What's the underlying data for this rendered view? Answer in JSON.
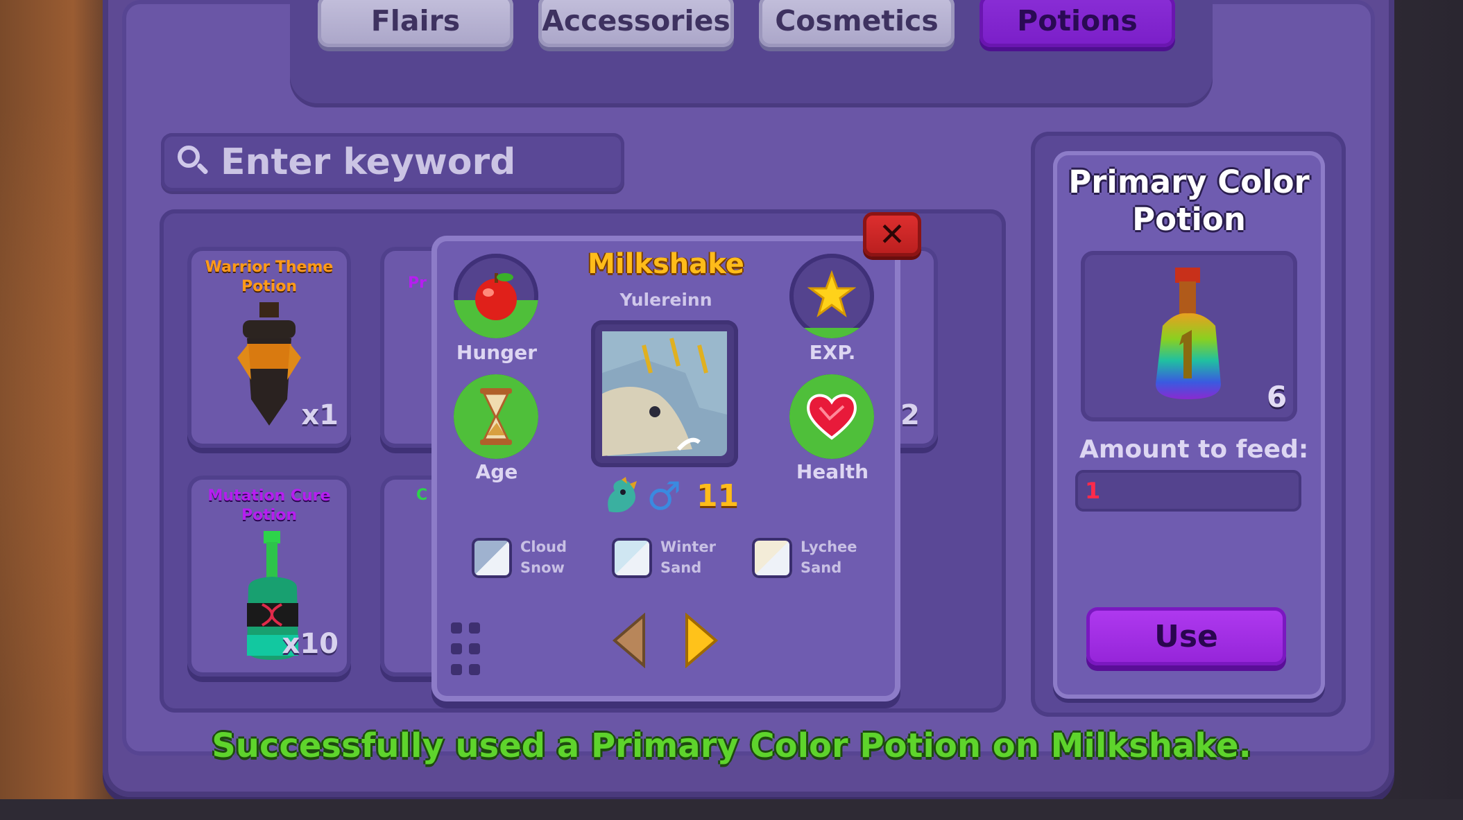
{
  "tabs": [
    {
      "label": "Flairs",
      "active": false
    },
    {
      "label": "Accessories",
      "active": false
    },
    {
      "label": "Cosmetics",
      "active": false
    },
    {
      "label": "Potions",
      "active": true
    }
  ],
  "search": {
    "placeholder": "Enter keyword"
  },
  "items": [
    {
      "name_line1": "Warrior Theme",
      "name_line2": "Potion",
      "count": "x1",
      "name_color": "#ff9a1a"
    },
    {
      "name_line1": "Mutation Cure",
      "name_line2": "Potion",
      "count": "x10",
      "name_color": "#b61ef0"
    }
  ],
  "partial_text": {
    "card2_top": "Pr",
    "card2_bottom": "C",
    "card3_count": "2"
  },
  "popup": {
    "close_label": "✕",
    "pet_name": "Milkshake",
    "species": "Yulereinn",
    "stats": {
      "hunger": {
        "label": "Hunger",
        "level": 0.45
      },
      "exp": {
        "label": "EXP.",
        "level": 0.12
      },
      "age": {
        "label": "Age"
      },
      "health": {
        "label": "Health"
      }
    },
    "gender": "male",
    "gender_symbol": "♂",
    "level": "11",
    "colors": [
      {
        "line1": "Cloud",
        "line2": "Snow",
        "hex": "#9fb2cf"
      },
      {
        "line1": "Winter",
        "line2": "Sand",
        "hex": "#cfe6f2"
      },
      {
        "line1": "Lychee",
        "line2": "Sand",
        "hex": "#f3ecd8"
      }
    ],
    "icons": [
      "apple-icon",
      "star-icon",
      "hourglass-icon",
      "heart-icon",
      "dragon-icon",
      "male-icon",
      "grid-menu-icon",
      "prev-arrow-icon",
      "next-arrow-icon"
    ]
  },
  "side": {
    "title_line1": "Primary Color",
    "title_line2": "Potion",
    "count": "6",
    "amount_label": "Amount to feed:",
    "amount_value": "1",
    "use_label": "Use"
  },
  "toast": "Successfully used a Primary Color Potion on Milkshake.",
  "colors": {
    "accent": "#7a1ec8",
    "success": "#5ed42c",
    "panel": "#6a56a6"
  }
}
